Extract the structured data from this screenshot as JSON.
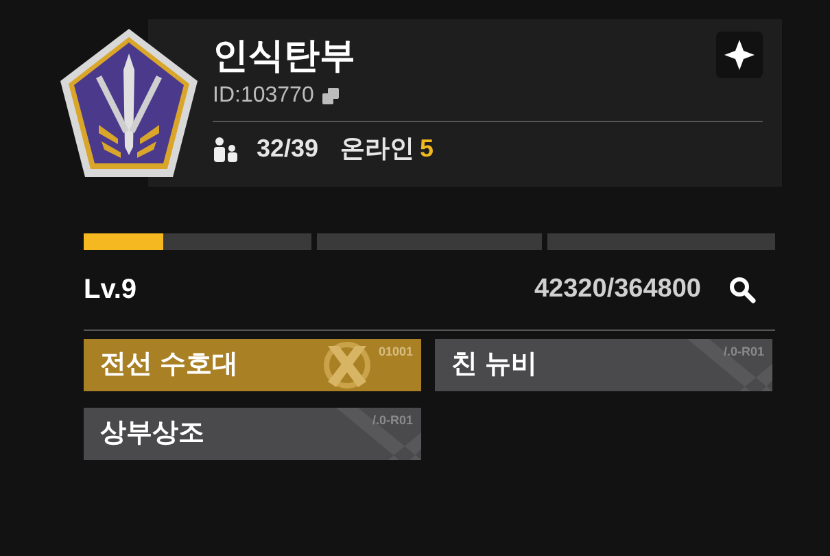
{
  "profile": {
    "name": "인식탄부",
    "id": "ID:103770",
    "members": "32/39",
    "online_label": "온라인",
    "online_count": "5"
  },
  "level": {
    "label": "Lv.9",
    "exp": "42320/364800",
    "level": 0.116
  },
  "tags": [
    {
      "label": "전선 수호대",
      "code": "01001",
      "kind": "gold"
    },
    {
      "label": "친 뉴비",
      "code": "/.0-R01",
      "kind": "plain"
    },
    {
      "label": "상부상조",
      "code": "/.0-R01",
      "kind": "plain"
    }
  ]
}
